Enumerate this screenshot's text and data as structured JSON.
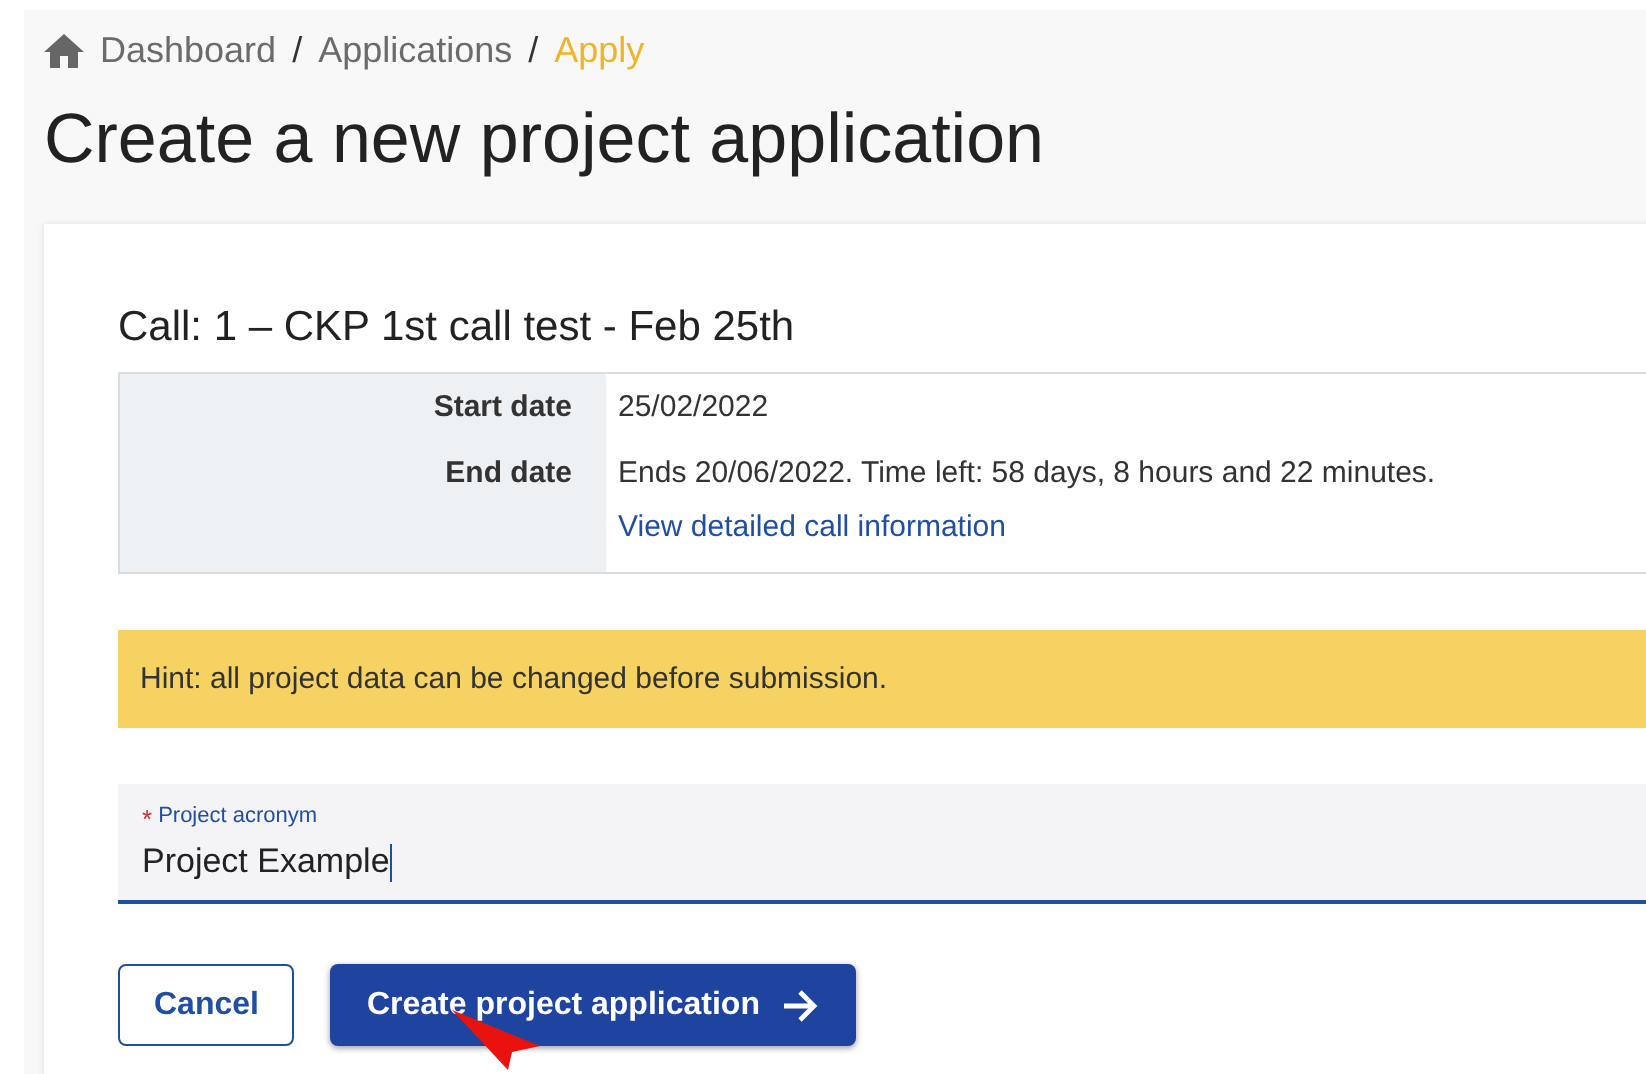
{
  "breadcrumb": [
    {
      "label": "Dashboard",
      "current": false
    },
    {
      "label": "Applications",
      "current": false
    },
    {
      "label": "Apply",
      "current": true
    }
  ],
  "breadcrumb_separator": "/",
  "page_title": "Create a new project application",
  "call": {
    "title": "Call: 1 – CKP 1st call test - Feb 25th",
    "details": [
      {
        "label": "Start date",
        "value": "25/02/2022"
      },
      {
        "label": "End date",
        "value": "Ends 20/06/2022. Time left: 58 days, 8 hours and 22 minutes.",
        "link": "View detailed call information"
      }
    ]
  },
  "hint": "Hint: all project data can be changed before submission.",
  "field": {
    "label": "Project acronym",
    "required": true,
    "required_mark": "*",
    "value": "Project Example"
  },
  "buttons": [
    {
      "label": "Cancel",
      "kind": "secondary"
    },
    {
      "label": "Create project application",
      "kind": "primary"
    }
  ]
}
